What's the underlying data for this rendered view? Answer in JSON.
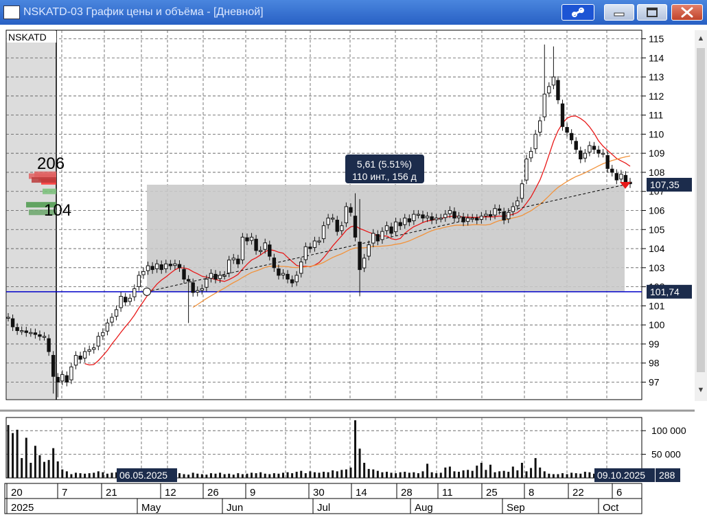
{
  "window": {
    "title": "NSKATD-03 График цены и объёма - [Дневной]",
    "icons": {
      "app": "chart-window-icon",
      "link": "link-icon",
      "minimize": "minimize-icon",
      "maximize": "maximize-icon",
      "close": "close-icon"
    }
  },
  "colors": {
    "titlebar": "#2f6cd0",
    "candle": "#111111",
    "ma_fast": "#e81818",
    "ma_slow": "#f2923a",
    "support": "#0000c8",
    "range_box": "#c8c8c8",
    "volume_bar": "#111111"
  },
  "chart_data": [
    {
      "type": "candlestick",
      "title": "NSKATD",
      "ylim": [
        96,
        115
      ],
      "yticks": [
        97,
        98,
        99,
        100,
        101,
        102,
        103,
        104,
        105,
        106,
        107,
        108,
        109,
        110,
        111,
        112,
        113,
        114,
        115
      ],
      "xtick_labels": [
        "20",
        "7",
        "21",
        "12",
        "26",
        "9",
        "30",
        "14",
        "28",
        "11",
        "25",
        "8",
        "22",
        "6"
      ],
      "month_labels": [
        "2025",
        "May",
        "Jun",
        "Jul",
        "Aug",
        "Sep",
        "Oct"
      ],
      "start_date": "06.05.2025",
      "end_date": "09.10.2025",
      "last_price": "107,35",
      "support_price": "101,74",
      "profile_labels": [
        "206",
        "104"
      ],
      "measure": {
        "change": "5,61 (5.51%)",
        "span": "110 инт., 156 д",
        "from": 101.74,
        "to": 107.35
      },
      "series": [
        {
          "name": "Close",
          "values": [
            100.4,
            99.9,
            99.7,
            99.7,
            99.6,
            99.6,
            99.5,
            99.4,
            99.4,
            98.6,
            97.3,
            97.0,
            97.4,
            97.0,
            97.8,
            98.4,
            98.2,
            98.6,
            98.7,
            98.8,
            99.4,
            99.6,
            100.1,
            100.4,
            100.8,
            101.5,
            101.2,
            101.4,
            101.9,
            102.6,
            102.8,
            103.1,
            102.9,
            103.2,
            102.9,
            103.2,
            103.1,
            103.2,
            103.0,
            102.4,
            102.3,
            101.7,
            101.8,
            101.9,
            102.4,
            102.7,
            102.4,
            102.6,
            102.6,
            103.4,
            103.5,
            103.2,
            104.6,
            104.4,
            104.6,
            103.9,
            103.9,
            104.3,
            103.6,
            103.0,
            102.6,
            102.7,
            102.4,
            102.2,
            102.6,
            103.3,
            104.1,
            104.0,
            104.4,
            104.4,
            105.2,
            105.6,
            105.6,
            104.9,
            105.2,
            106.2,
            105.9,
            104.6,
            102.9,
            103.5,
            104.2,
            104.8,
            104.4,
            104.9,
            105.2,
            104.8,
            105.4,
            105.2,
            105.6,
            105.4,
            105.8,
            105.8,
            105.6,
            105.7,
            105.5,
            105.6,
            105.6,
            105.8,
            106.0,
            105.6,
            105.7,
            105.4,
            105.6,
            105.6,
            105.5,
            105.7,
            105.8,
            105.7,
            106.1,
            106.0,
            105.5,
            105.9,
            106.2,
            106.5,
            107.4,
            108.7,
            109.1,
            110.0,
            110.7,
            112.1,
            112.5,
            113.0,
            111.8,
            110.4,
            110.1,
            109.7,
            109.2,
            108.7,
            109.0,
            109.4,
            109.2,
            109.0,
            109.0,
            108.2,
            108.0,
            107.6,
            107.9,
            107.5,
            107.4
          ]
        },
        {
          "name": "Volume",
          "values": [
            112000,
            95000,
            102000,
            42000,
            85000,
            32000,
            68000,
            48000,
            34000,
            38000,
            63000,
            35000,
            18000,
            14000,
            8000,
            11000,
            10000,
            9000,
            10000,
            11000,
            14000,
            12000,
            9000,
            11000,
            12000,
            15000,
            8000,
            12000,
            9000,
            13000,
            14000,
            12000,
            10000,
            8000,
            9000,
            7000,
            8000,
            12000,
            10000,
            8000,
            7000,
            11000,
            9000,
            8000,
            7000,
            10000,
            9000,
            11000,
            8000,
            9000,
            7000,
            10000,
            8000,
            9000,
            11000,
            10000,
            12000,
            9000,
            8000,
            10000,
            9000,
            11000,
            12000,
            10000,
            13000,
            15000,
            10000,
            14000,
            12000,
            11000,
            13000,
            12000,
            16000,
            14000,
            17000,
            18000,
            22000,
            122000,
            62000,
            32000,
            19000,
            18000,
            15000,
            12000,
            13000,
            11000,
            10000,
            12000,
            13000,
            11000,
            12000,
            10000,
            14000,
            30000,
            12000,
            10000,
            11000,
            22000,
            24000,
            14000,
            13000,
            16000,
            17000,
            15000,
            26000,
            32000,
            17000,
            28000,
            12000,
            14000,
            15000,
            13000,
            24000,
            16000,
            32000,
            14000,
            21000,
            42000,
            22000,
            14000,
            9000,
            8000,
            8000,
            10000,
            8000,
            11000,
            10000,
            9000,
            13000,
            12000,
            9000,
            10000,
            8000,
            10000,
            9000,
            8000,
            7000,
            8000,
            7000,
            8000,
            7000
          ]
        }
      ]
    },
    {
      "type": "bar",
      "title": "",
      "ylim": [
        0,
        125000
      ],
      "yticks": [
        "100 000",
        "50 000"
      ],
      "last_volume": "288"
    }
  ]
}
